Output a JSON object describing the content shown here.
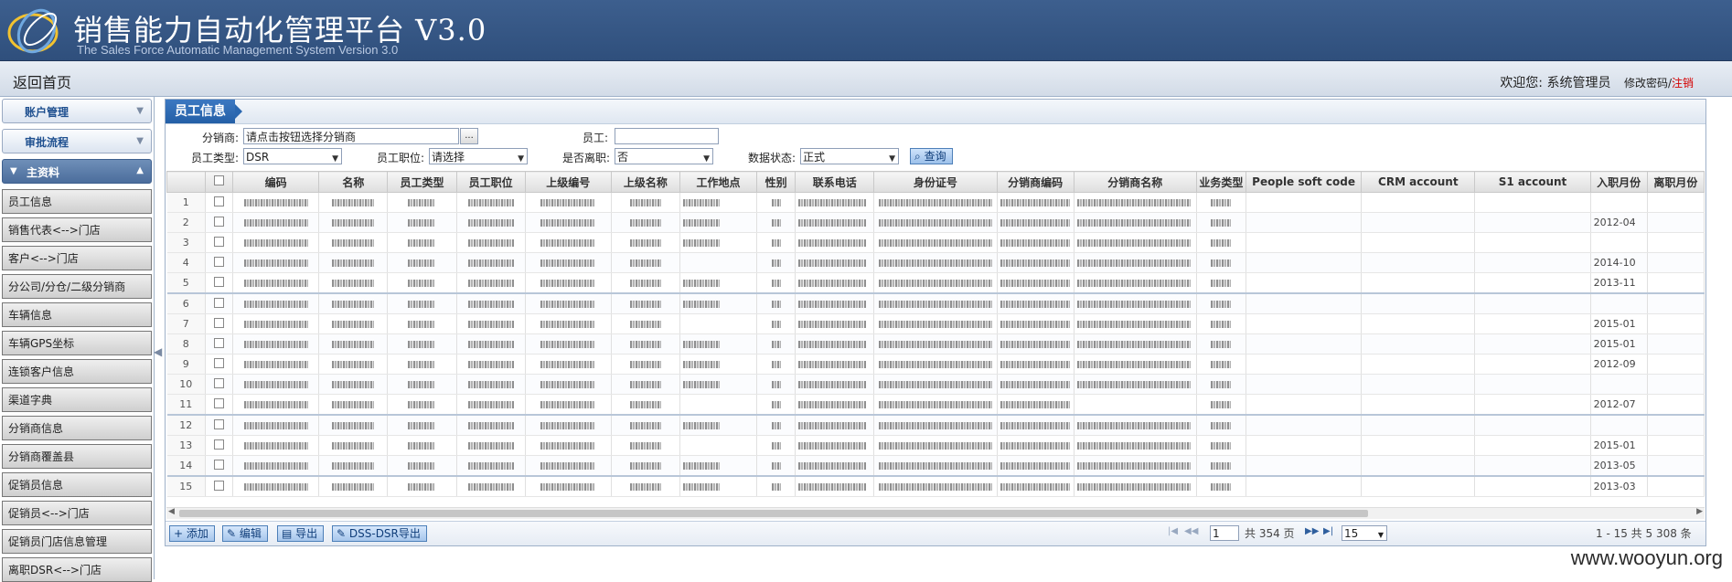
{
  "app": {
    "title": "销售能力自动化管理平台 V3.0",
    "subtitle": "The Sales Force Automatic Management System   Version 3.0"
  },
  "nav": {
    "home": "返回首页",
    "welcome": "欢迎您: 系统管理员",
    "change_password": "修改密码/",
    "logout": "注销"
  },
  "sidebar": {
    "groups": [
      {
        "label": "账户管理"
      },
      {
        "label": "审批流程"
      },
      {
        "label": "主资料"
      }
    ],
    "items": [
      "员工信息",
      "销售代表<-->门店",
      "客户<-->门店",
      "分公司/分仓/二级分销商",
      "车辆信息",
      "车辆GPS坐标",
      "连锁客户信息",
      "渠道字典",
      "分销商信息",
      "分销商覆盖县",
      "促销员信息",
      "促销员<-->门店",
      "促销员门店信息管理",
      "离职DSR<-->门店"
    ]
  },
  "panel": {
    "title": "员工信息"
  },
  "filters": {
    "distributor_label": "分销商:",
    "distributor_value": "请点击按钮选择分销商",
    "dots": "...",
    "employee_label": "员工:",
    "employee_value": "",
    "emp_type_label": "员工类型:",
    "emp_type_value": "DSR",
    "emp_position_label": "员工职位:",
    "emp_position_value": "请选择",
    "resigned_label": "是否离职:",
    "resigned_value": "否",
    "status_label": "数据状态:",
    "status_value": "正式",
    "query": "查询"
  },
  "grid": {
    "columns": [
      "",
      "",
      "编码",
      "名称",
      "员工类型",
      "员工职位",
      "上级编号",
      "上级名称",
      "工作地点",
      "性别",
      "联系电话",
      "身份证号",
      "分销商编码",
      "分销商名称",
      "业务类型",
      "People soft code",
      "CRM account",
      "S1 account",
      "入职月份",
      "离职月份"
    ],
    "rows": [
      {
        "num": "1",
        "join": ""
      },
      {
        "num": "2",
        "join": "2012-04"
      },
      {
        "num": "3",
        "join": ""
      },
      {
        "num": "4",
        "join": "2014-10"
      },
      {
        "num": "5",
        "join": "2013-11"
      },
      {
        "num": "6",
        "join": ""
      },
      {
        "num": "7",
        "join": "2015-01"
      },
      {
        "num": "8",
        "join": "2015-01"
      },
      {
        "num": "9",
        "join": "2012-09"
      },
      {
        "num": "10",
        "join": ""
      },
      {
        "num": "11",
        "join": "2012-07"
      },
      {
        "num": "12",
        "join": ""
      },
      {
        "num": "13",
        "join": "2015-01"
      },
      {
        "num": "14",
        "join": "2013-05"
      },
      {
        "num": "15",
        "join": "2013-03"
      }
    ]
  },
  "toolbar": {
    "add": "添加",
    "edit": "编辑",
    "export": "导出",
    "dss_export": "DSS-DSR导出"
  },
  "pager": {
    "page": "1",
    "total_pages": "共 354 页",
    "page_size": "15",
    "range": "1 - 15  共 5 308 条"
  },
  "watermark": "www.wooyun.org",
  "colors": {
    "header": "#2f4f7c",
    "accent": "#235fa6"
  }
}
